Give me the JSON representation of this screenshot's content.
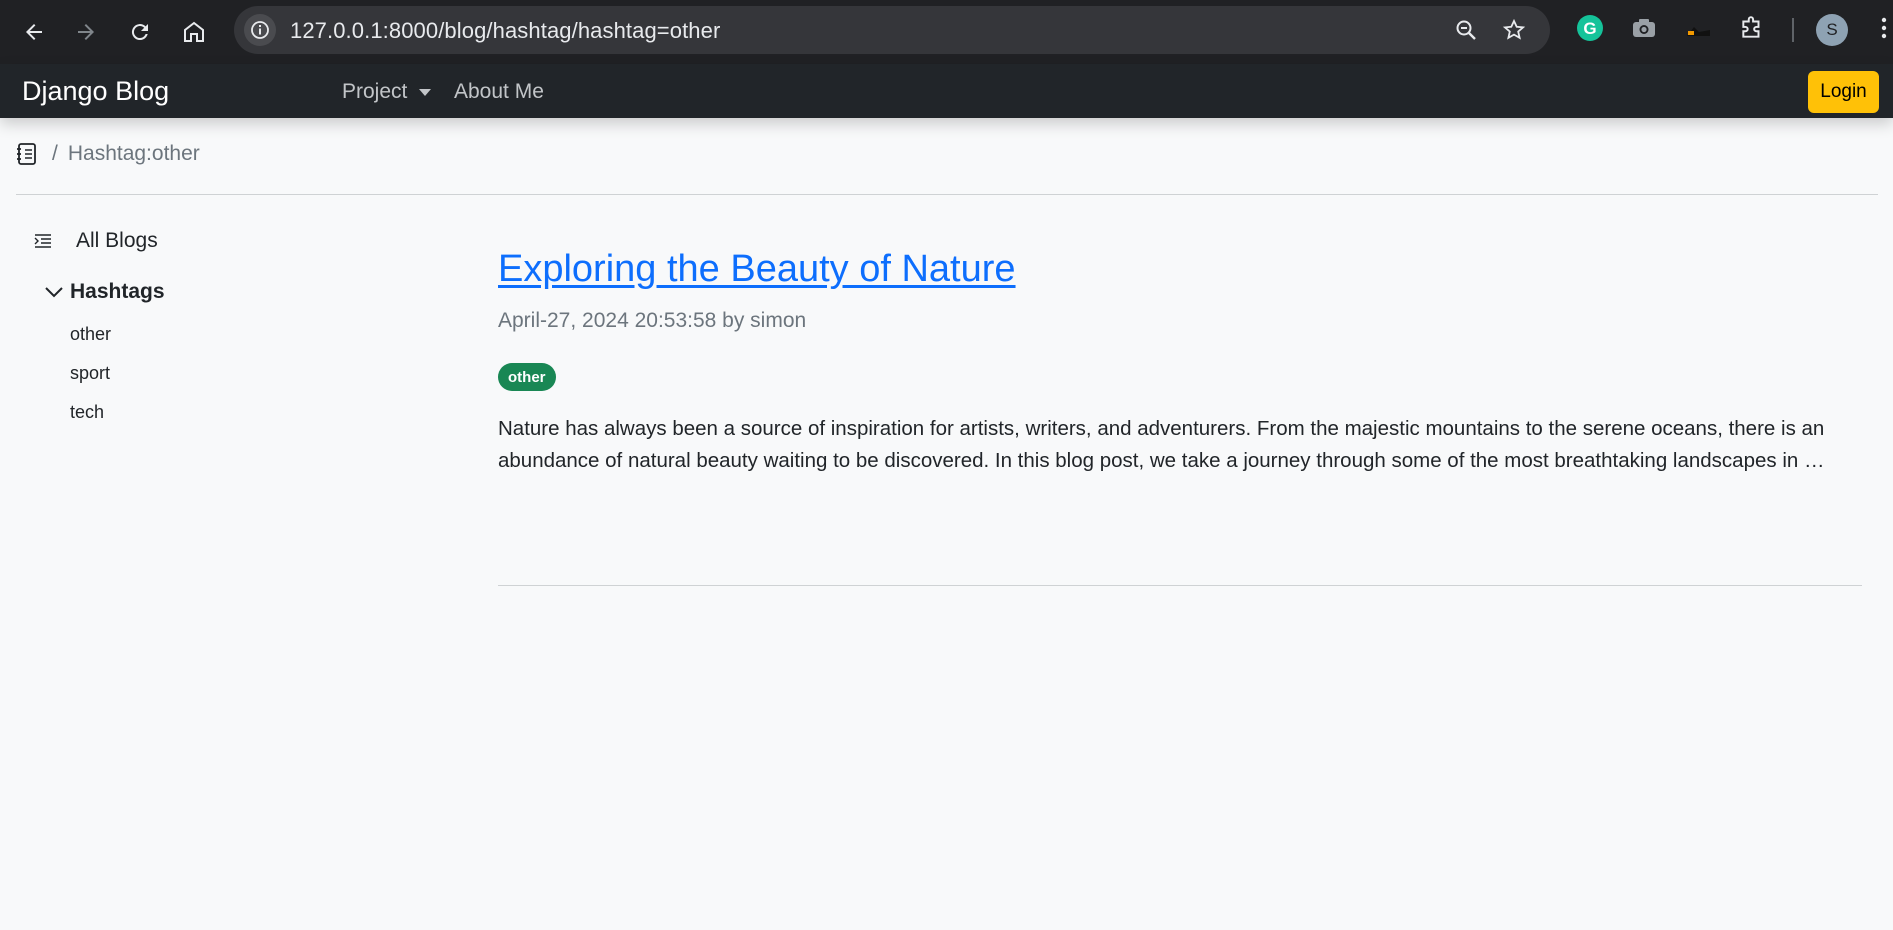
{
  "browser": {
    "url": "127.0.0.1:8000/blog/hashtag/hashtag=other",
    "profile_initial": "S",
    "icons": [
      "back-icon",
      "forward-icon",
      "reload-icon",
      "home-icon",
      "site-info-icon",
      "zoom-icon",
      "bookmark-star-icon",
      "grammarly-icon",
      "camera-icon",
      "extension-icon",
      "puzzle-icon"
    ]
  },
  "navbar": {
    "brand": "Django Blog",
    "items": [
      {
        "label": "Project",
        "dropdown": true
      },
      {
        "label": "About Me",
        "dropdown": false
      }
    ],
    "login_label": "Login",
    "login_color": "#ffc107"
  },
  "breadcrumb": {
    "icon": "journal-icon",
    "separator": "/",
    "current": "Hashtag:other"
  },
  "sidebar": {
    "all_blogs": "All Blogs",
    "hashtags_title": "Hashtags",
    "hashtags": [
      "other",
      "sport",
      "tech"
    ]
  },
  "post": {
    "title": "Exploring the Beauty of Nature",
    "meta": "April-27, 2024 20:53:58 by simon",
    "badge": "other",
    "badge_color": "#198754",
    "excerpt": "Nature has always been a source of inspiration for artists, writers, and adventurers. From the majestic mountains to the serene oceans, there is an abundance of natural beauty waiting to be discovered. In this blog post, we take a journey through some of the most breathtaking landscapes in …"
  }
}
